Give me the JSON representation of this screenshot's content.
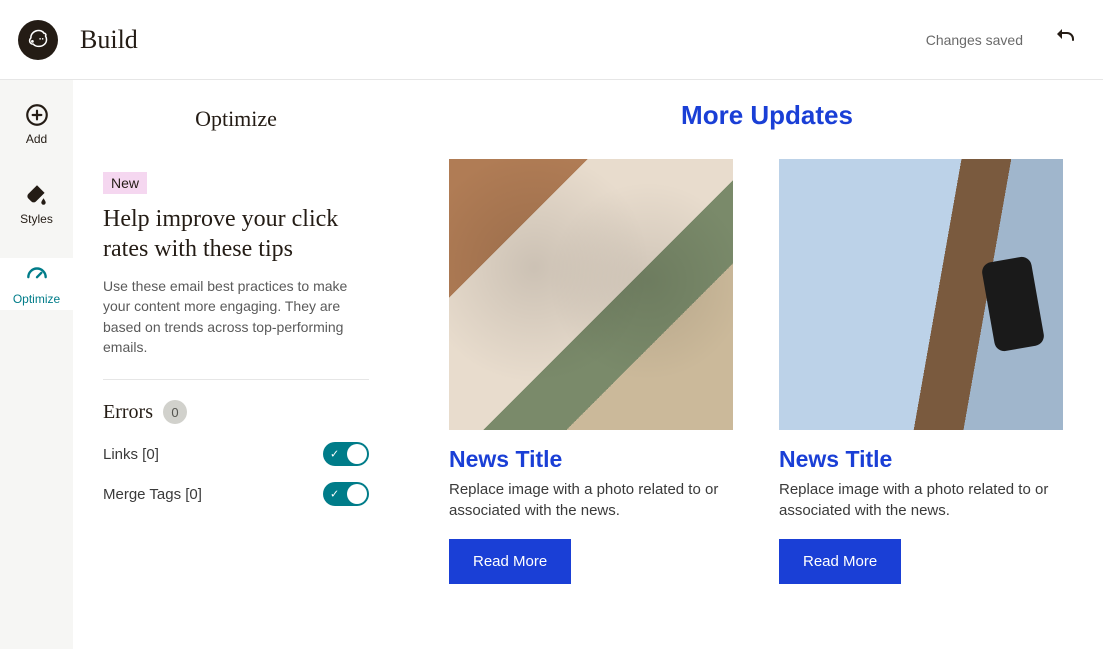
{
  "header": {
    "title": "Build",
    "status": "Changes saved"
  },
  "rail": {
    "items": [
      {
        "label": "Add"
      },
      {
        "label": "Styles"
      },
      {
        "label": "Optimize"
      }
    ]
  },
  "panel": {
    "title": "Optimize",
    "badge": "New",
    "heading": "Help improve your click rates with these tips",
    "description": "Use these email best practices to make your content more engaging. They are based on trends across top-performing emails.",
    "errors_label": "Errors",
    "errors_count": "0",
    "checks": [
      {
        "label": "Links [0]"
      },
      {
        "label": "Merge Tags [0]"
      }
    ]
  },
  "canvas": {
    "section_title": "More Updates",
    "news": [
      {
        "title": "News Title",
        "desc": "Replace image with a photo related to or associated with the news.",
        "cta": "Read More"
      },
      {
        "title": "News Title",
        "desc": "Replace image with a photo related to or associated with the news.",
        "cta": "Read More"
      }
    ]
  }
}
